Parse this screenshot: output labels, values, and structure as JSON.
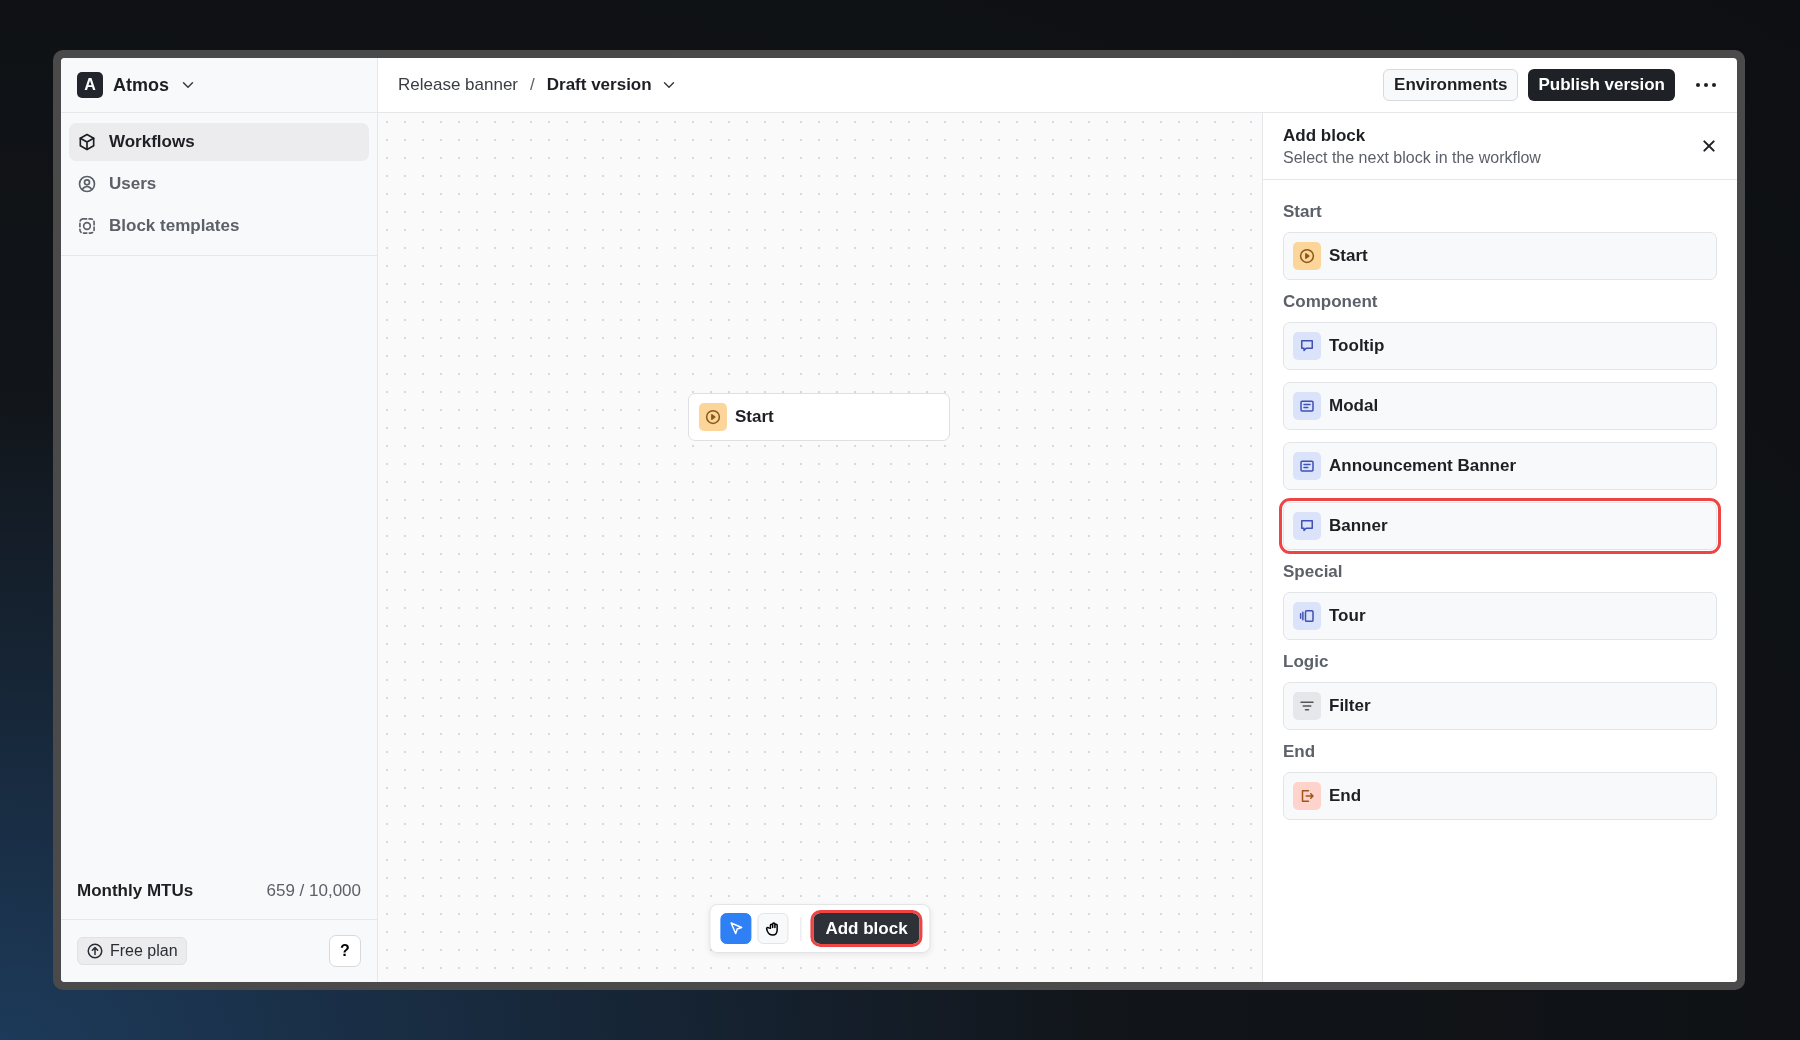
{
  "workspace": {
    "initial": "A",
    "name": "Atmos"
  },
  "nav": [
    {
      "kind": "cube",
      "label": "Workflows",
      "selected": true
    },
    {
      "kind": "user",
      "label": "Users",
      "selected": false
    },
    {
      "kind": "template",
      "label": "Block templates",
      "selected": false
    }
  ],
  "usage": {
    "label": "Monthly MTUs",
    "value": "659 / 10,000"
  },
  "plan": {
    "label": "Free plan"
  },
  "help": {
    "label": "?"
  },
  "breadcrumb": {
    "parent": "Release banner",
    "separator": "/",
    "current": "Draft version"
  },
  "actions": {
    "environments": "Environments",
    "publish": "Publish version"
  },
  "canvas": {
    "nodes": [
      {
        "kind": "start",
        "label": "Start"
      }
    ],
    "tools": [
      {
        "kind": "pointer",
        "selected": true
      },
      {
        "kind": "hand",
        "selected": false
      }
    ],
    "add_button": {
      "label": "Add block",
      "highlighted": true
    }
  },
  "panel": {
    "title": "Add block",
    "subtitle": "Select the next block in the workflow",
    "groups": [
      {
        "title": "Start",
        "items": [
          {
            "kind": "start",
            "label": "Start",
            "highlighted": false
          }
        ]
      },
      {
        "title": "Component",
        "items": [
          {
            "kind": "tooltip",
            "label": "Tooltip",
            "highlighted": false
          },
          {
            "kind": "modal",
            "label": "Modal",
            "highlighted": false
          },
          {
            "kind": "modal",
            "label": "Announcement Banner",
            "highlighted": false
          },
          {
            "kind": "tooltip",
            "label": "Banner",
            "highlighted": true
          }
        ]
      },
      {
        "title": "Special",
        "items": [
          {
            "kind": "tour",
            "label": "Tour",
            "highlighted": false
          }
        ]
      },
      {
        "title": "Logic",
        "items": [
          {
            "kind": "filter",
            "label": "Filter",
            "highlighted": false
          }
        ]
      },
      {
        "title": "End",
        "items": [
          {
            "kind": "end",
            "label": "End",
            "highlighted": false
          }
        ]
      }
    ]
  }
}
